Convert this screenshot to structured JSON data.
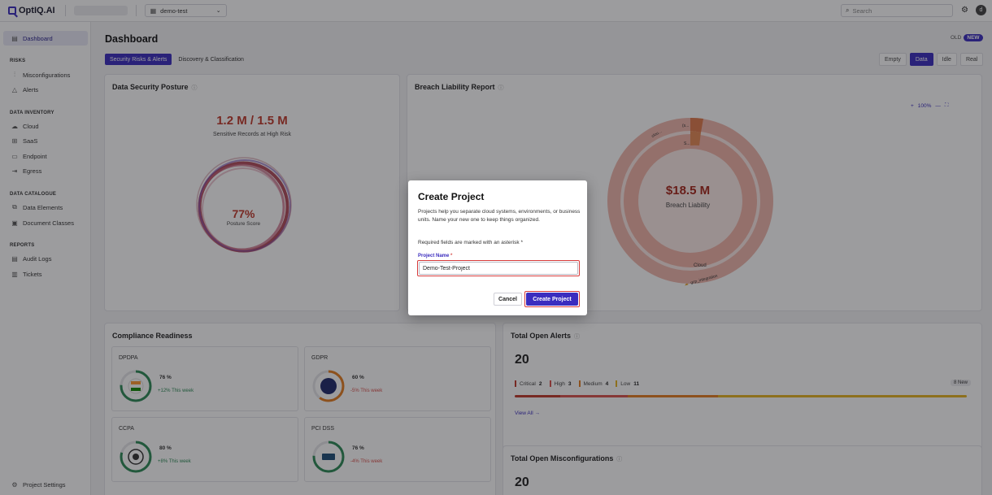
{
  "app": {
    "brand": "OptIQ.AI",
    "project_selector": "demo-test",
    "search_placeholder": "Search",
    "avatar_initial": "d"
  },
  "sidebar": {
    "dashboard": "Dashboard",
    "risks_head": "RISKS",
    "misconfigurations": "Misconfigurations",
    "alerts": "Alerts",
    "inventory_head": "DATA INVENTORY",
    "cloud": "Cloud",
    "saas": "SaaS",
    "endpoint": "Endpoint",
    "egress": "Egress",
    "catalogue_head": "DATA CATALOGUE",
    "data_elements": "Data Elements",
    "document_classes": "Document Classes",
    "reports_head": "REPORTS",
    "audit_logs": "Audit Logs",
    "tickets": "Tickets",
    "project_settings": "Project Settings"
  },
  "header": {
    "title": "Dashboard",
    "old": "OLD",
    "new": "NEW",
    "tabs": [
      "Security Risks & Alerts",
      "Discovery & Classification"
    ],
    "modes": [
      "Empty",
      "Data",
      "Idle",
      "Real"
    ]
  },
  "posture": {
    "title": "Data Security Posture",
    "ratio": "1.2 M / 1.5 M",
    "ratio_label": "Sensitive Records at High Risk",
    "score": "77%",
    "score_label": "Posture Score"
  },
  "breach": {
    "title": "Breach Liability Report",
    "zoom_in": "+",
    "zoom": "100%",
    "zoom_out": "—",
    "fit": "⛶",
    "value": "$18.5 M",
    "label": "Breach Liability",
    "seg_cloud_short": "clou...",
    "seg_small1": "(s...",
    "seg_small2": "S...",
    "cloud": "Cloud",
    "gcp": "gcp_integration"
  },
  "compliance": {
    "title": "Compliance Readiness",
    "items": [
      {
        "name": "DPDPA",
        "pct": "76 %",
        "trend": "+12% This week"
      },
      {
        "name": "GDPR",
        "pct": "60 %",
        "trend": "-5% This week"
      },
      {
        "name": "CCPA",
        "pct": "80 %",
        "trend": "+8% This week"
      },
      {
        "name": "PCI DSS",
        "pct": "76 %",
        "trend": "-4% This week"
      }
    ]
  },
  "alerts": {
    "title": "Total Open Alerts",
    "total": "20",
    "critical_label": "Critical",
    "critical": "2",
    "high_label": "High",
    "high": "3",
    "medium_label": "Medium",
    "medium": "4",
    "low_label": "Low",
    "low": "11",
    "new_tag": "8 New",
    "view_all": "View All →"
  },
  "misconfig": {
    "title": "Total Open Misconfigurations",
    "total": "20"
  },
  "modal": {
    "title": "Create Project",
    "description": "Projects help you separate cloud systems, environments, or business units. Name your new one to keep things organized.",
    "required_note": "Required fields are marked with an asterisk *",
    "field_label": "Project Name",
    "field_star": "*",
    "field_value": "Demo-Test-Project",
    "cancel": "Cancel",
    "create": "Create Project"
  },
  "colors": {
    "accent": "#3b2dbf",
    "risk": "#c0392b",
    "critical": "#c0392b",
    "high": "#d9534f",
    "medium": "#e67e22",
    "low": "#e6b422"
  }
}
